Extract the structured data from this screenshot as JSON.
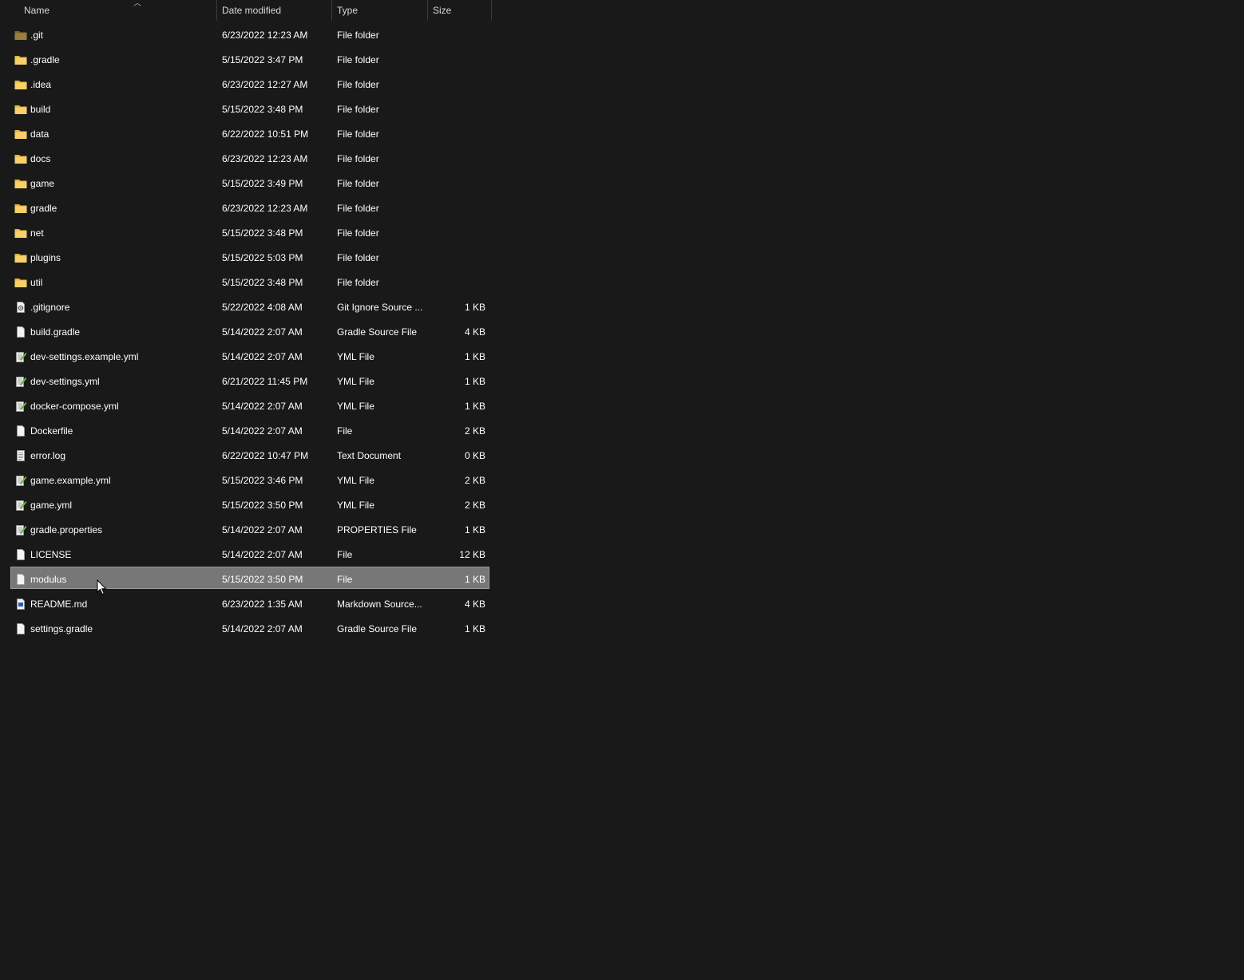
{
  "columns": {
    "name": "Name",
    "date": "Date modified",
    "type": "Type",
    "size": "Size"
  },
  "sort": {
    "column": "name",
    "direction": "ascending",
    "icon": "chevron-up-icon"
  },
  "icons": {
    "folder": "folder-icon",
    "git_folder": "folder-dark-icon",
    "generic": "document-icon",
    "text": "text-document-icon",
    "yml": "yml-file-icon",
    "settings": "gear-file-icon",
    "markdown": "markdown-file-icon"
  },
  "colors": {
    "background": "#191919",
    "folder": "#f0c048",
    "folder_dark": "#9a7f3a",
    "selected_row": "#777777"
  },
  "files": [
    {
      "name": ".git",
      "date": "6/23/2022 12:23 AM",
      "type": "File folder",
      "size": "",
      "icon": "git_folder"
    },
    {
      "name": ".gradle",
      "date": "5/15/2022 3:47 PM",
      "type": "File folder",
      "size": "",
      "icon": "folder"
    },
    {
      "name": ".idea",
      "date": "6/23/2022 12:27 AM",
      "type": "File folder",
      "size": "",
      "icon": "folder"
    },
    {
      "name": "build",
      "date": "5/15/2022 3:48 PM",
      "type": "File folder",
      "size": "",
      "icon": "folder"
    },
    {
      "name": "data",
      "date": "6/22/2022 10:51 PM",
      "type": "File folder",
      "size": "",
      "icon": "folder"
    },
    {
      "name": "docs",
      "date": "6/23/2022 12:23 AM",
      "type": "File folder",
      "size": "",
      "icon": "folder"
    },
    {
      "name": "game",
      "date": "5/15/2022 3:49 PM",
      "type": "File folder",
      "size": "",
      "icon": "folder"
    },
    {
      "name": "gradle",
      "date": "6/23/2022 12:23 AM",
      "type": "File folder",
      "size": "",
      "icon": "folder"
    },
    {
      "name": "net",
      "date": "5/15/2022 3:48 PM",
      "type": "File folder",
      "size": "",
      "icon": "folder"
    },
    {
      "name": "plugins",
      "date": "5/15/2022 5:03 PM",
      "type": "File folder",
      "size": "",
      "icon": "folder"
    },
    {
      "name": "util",
      "date": "5/15/2022 3:48 PM",
      "type": "File folder",
      "size": "",
      "icon": "folder"
    },
    {
      "name": ".gitignore",
      "date": "5/22/2022 4:08 AM",
      "type": "Git Ignore Source ...",
      "size": "1 KB",
      "icon": "settings"
    },
    {
      "name": "build.gradle",
      "date": "5/14/2022 2:07 AM",
      "type": "Gradle Source File",
      "size": "4 KB",
      "icon": "generic"
    },
    {
      "name": "dev-settings.example.yml",
      "date": "5/14/2022 2:07 AM",
      "type": "YML File",
      "size": "1 KB",
      "icon": "yml"
    },
    {
      "name": "dev-settings.yml",
      "date": "6/21/2022 11:45 PM",
      "type": "YML File",
      "size": "1 KB",
      "icon": "yml"
    },
    {
      "name": "docker-compose.yml",
      "date": "5/14/2022 2:07 AM",
      "type": "YML File",
      "size": "1 KB",
      "icon": "yml"
    },
    {
      "name": "Dockerfile",
      "date": "5/14/2022 2:07 AM",
      "type": "File",
      "size": "2 KB",
      "icon": "generic"
    },
    {
      "name": "error.log",
      "date": "6/22/2022 10:47 PM",
      "type": "Text Document",
      "size": "0 KB",
      "icon": "text"
    },
    {
      "name": "game.example.yml",
      "date": "5/15/2022 3:46 PM",
      "type": "YML File",
      "size": "2 KB",
      "icon": "yml"
    },
    {
      "name": "game.yml",
      "date": "5/15/2022 3:50 PM",
      "type": "YML File",
      "size": "2 KB",
      "icon": "yml"
    },
    {
      "name": "gradle.properties",
      "date": "5/14/2022 2:07 AM",
      "type": "PROPERTIES File",
      "size": "1 KB",
      "icon": "yml"
    },
    {
      "name": "LICENSE",
      "date": "5/14/2022 2:07 AM",
      "type": "File",
      "size": "12 KB",
      "icon": "generic"
    },
    {
      "name": "modulus",
      "date": "5/15/2022 3:50 PM",
      "type": "File",
      "size": "1 KB",
      "icon": "generic",
      "selected": true
    },
    {
      "name": "README.md",
      "date": "6/23/2022 1:35 AM",
      "type": "Markdown Source...",
      "size": "4 KB",
      "icon": "markdown"
    },
    {
      "name": "settings.gradle",
      "date": "5/14/2022 2:07 AM",
      "type": "Gradle Source File",
      "size": "1 KB",
      "icon": "generic"
    }
  ]
}
